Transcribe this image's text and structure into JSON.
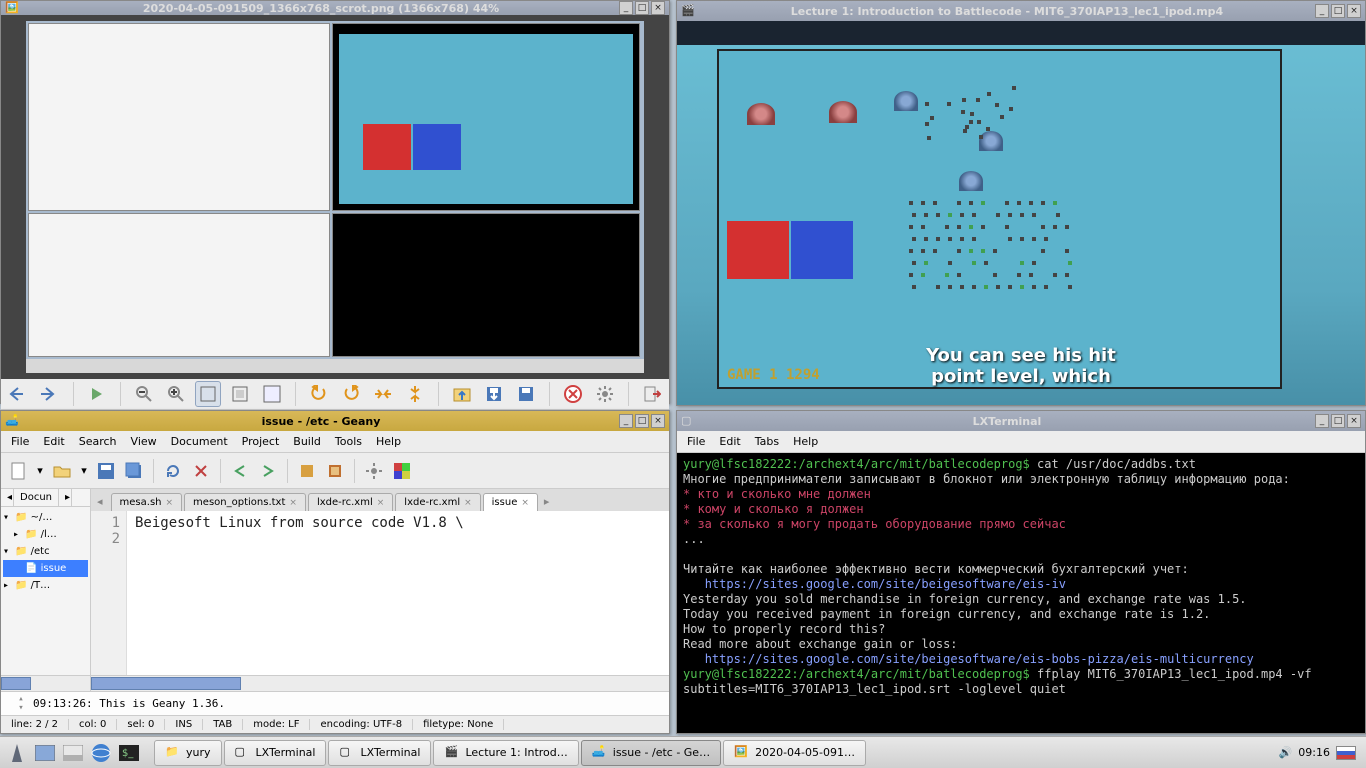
{
  "viewer": {
    "title": "2020-04-05-091509_1366x768_scrot.png (1366x768) 44%"
  },
  "video": {
    "title": "Lecture 1: Introduction to Battlecode - MIT6_370IAP13_lec1_ipod.mp4",
    "subtitle": "You can see his hit\npoint level, which",
    "game_label": "GAME 1   1294"
  },
  "geany": {
    "title": "issue - /etc - Geany",
    "menu": [
      "File",
      "Edit",
      "Search",
      "View",
      "Document",
      "Project",
      "Build",
      "Tools",
      "Help"
    ],
    "side_tab": "Docun",
    "tree": [
      {
        "exp": "▾",
        "label": "~/…"
      },
      {
        "exp": "▸",
        "label": "/l…",
        "indent": 1
      },
      {
        "exp": "▾",
        "label": "/etc",
        "indent": 0
      },
      {
        "exp": "",
        "label": "issue",
        "indent": 1,
        "sel": true,
        "file": true
      },
      {
        "exp": "▸",
        "label": "/T…",
        "indent": 0
      }
    ],
    "tabs": [
      {
        "label": "mesa.sh"
      },
      {
        "label": "meson_options.txt"
      },
      {
        "label": "lxde-rc.xml"
      },
      {
        "label": "lxde-rc.xml"
      },
      {
        "label": "issue",
        "active": true
      }
    ],
    "code_lines": [
      "1",
      "2"
    ],
    "code_text": "Beigesoft Linux from source code V1.8 \\\n",
    "msg": "09:13:26: This is Geany 1.36.",
    "status": {
      "line": "line: 2 / 2",
      "col": "col: 0",
      "sel": "sel: 0",
      "ins": "INS",
      "tab": "TAB",
      "mode": "mode: LF",
      "enc": "encoding: UTF-8",
      "ft": "filetype: None"
    }
  },
  "term": {
    "title": "LXTerminal",
    "menu": [
      "File",
      "Edit",
      "Tabs",
      "Help"
    ],
    "prompt1": "yury@lfsc182222:/archext4/arc/mit/batlecodeprog$",
    "cmd1": " cat /usr/doc/addbs.txt",
    "line1": "Многие предприниматели записывают в блокнот или электронную таблицу информацию рода:",
    "b1": "* кто и сколько мне должен",
    "b2": "* кому и сколько я должен",
    "b3": "* за сколько я могу продать оборудование прямо сейчас",
    "dots": "...",
    "line2": "Читайте как наиболее эффективно вести коммерческий бухгалтерский учет:",
    "link1": "   https://sites.google.com/site/beigesoftware/eis-iv",
    "line3": "Yesterday you sold merchandise in foreign currency, and exchange rate was 1.5.",
    "line4": "Today you received payment in foreign currency, and exchange rate is 1.2.",
    "line5": "How to properly record this?",
    "line6": "Read more about exchange gain or loss:",
    "link2": "   https://sites.google.com/site/beigesoftware/eis-bobs-pizza/eis-multicurrency",
    "prompt2": "yury@lfsc182222:/archext4/arc/mit/batlecodeprog$",
    "cmd2": " ffplay MIT6_370IAP13_lec1_ipod.mp4 -vf subtitles=MIT6_370IAP13_lec1_ipod.srt -loglevel quiet"
  },
  "taskbar": {
    "items": [
      {
        "label": "yury",
        "icon": "folder"
      },
      {
        "label": "LXTerminal",
        "icon": "term"
      },
      {
        "label": "LXTerminal",
        "icon": "term"
      },
      {
        "label": "Lecture 1: Introd…",
        "icon": "video"
      },
      {
        "label": "issue - /etc - Ge…",
        "icon": "geany",
        "active": true
      },
      {
        "label": "2020-04-05-091…",
        "icon": "image"
      }
    ],
    "clock": "09:16"
  }
}
